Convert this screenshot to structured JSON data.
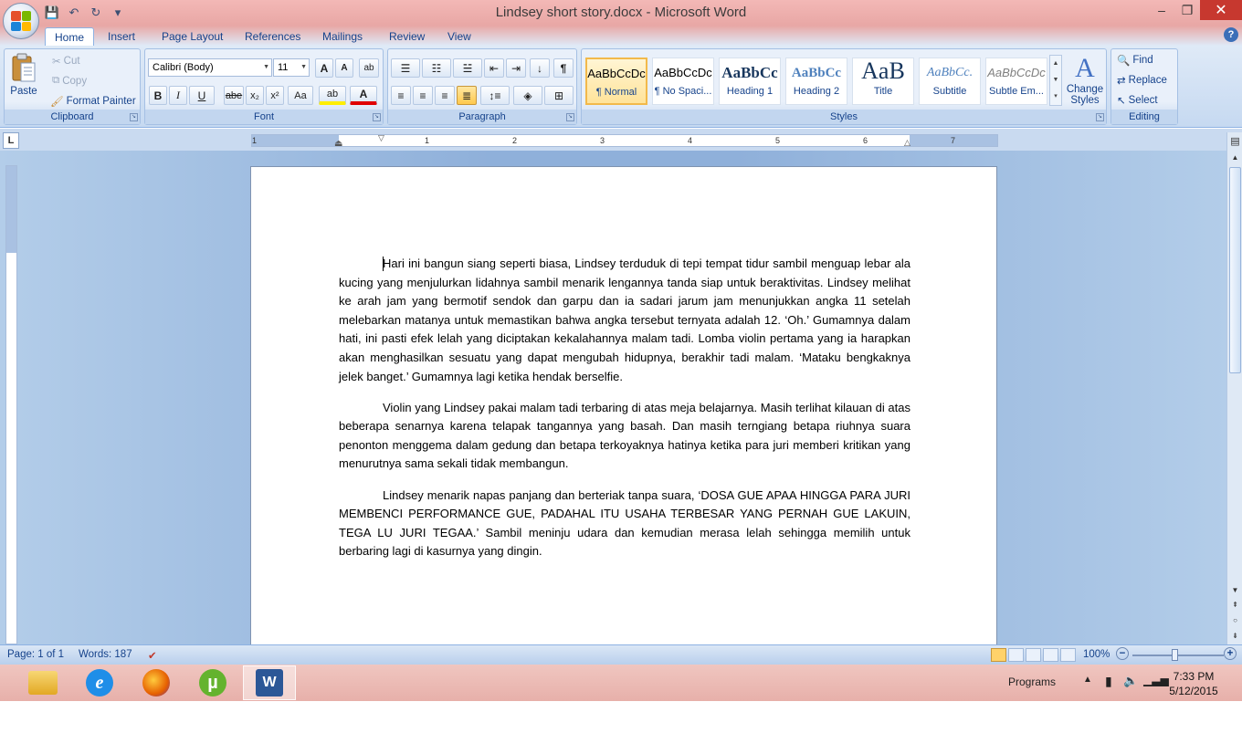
{
  "window": {
    "title": "Lindsey short story.docx - Microsoft Word",
    "minimize": "–",
    "restore": "❐",
    "close": "✕"
  },
  "qat": {
    "save": "💾",
    "undo": "↶",
    "redo": "↻",
    "more": "▾"
  },
  "tabs": [
    {
      "label": "Home",
      "active": true
    },
    {
      "label": "Insert"
    },
    {
      "label": "Page Layout"
    },
    {
      "label": "References"
    },
    {
      "label": "Mailings"
    },
    {
      "label": "Review"
    },
    {
      "label": "View"
    }
  ],
  "help": "?",
  "clipboard": {
    "label": "Clipboard",
    "paste": "Paste",
    "cut": "Cut",
    "copy": "Copy",
    "format_painter": "Format Painter"
  },
  "font": {
    "label": "Font",
    "family": "Calibri (Body)",
    "size": "11",
    "grow": "A",
    "shrink": "A",
    "clear": "ab",
    "bold": "B",
    "italic": "I",
    "underline": "U",
    "strike": "abe",
    "subscript": "x₂",
    "superscript": "x²",
    "case": "Aa",
    "highlight": "ab",
    "color": "A"
  },
  "paragraph": {
    "label": "Paragraph",
    "sort": "↓",
    "show_marks": "¶"
  },
  "styles": {
    "label": "Styles",
    "items": [
      {
        "preview": "AaBbCcDc",
        "name": "¶ Normal",
        "selected": true
      },
      {
        "preview": "AaBbCcDc",
        "name": "¶ No Spaci..."
      },
      {
        "preview": "AaBbCc",
        "name": "Heading 1"
      },
      {
        "preview": "AaBbCc",
        "name": "Heading 2"
      },
      {
        "preview": "AaB",
        "name": "Title"
      },
      {
        "preview": "AaBbCc.",
        "name": "Subtitle"
      },
      {
        "preview": "AaBbCcDc",
        "name": "Subtle Em..."
      }
    ],
    "change_styles": "Change Styles"
  },
  "editing": {
    "label": "Editing",
    "find": "Find",
    "replace": "Replace",
    "select": "Select"
  },
  "ruler": {
    "corner": "L",
    "numbers": [
      "1",
      "1",
      "2",
      "3",
      "4",
      "5",
      "6",
      "7"
    ]
  },
  "document": {
    "paragraphs": [
      "Hari ini bangun siang seperti biasa, Lindsey terduduk di tepi tempat tidur sambil menguap lebar ala kucing yang menjulurkan lidahnya sambil menarik lengannya tanda siap untuk beraktivitas. Lindsey melihat ke arah jam yang bermotif sendok dan garpu dan ia sadari jarum jam menunjukkan angka 11 setelah melebarkan matanya untuk memastikan bahwa angka tersebut ternyata adalah 12. ‘Oh.’ Gumamnya dalam hati, ini pasti efek lelah yang diciptakan kekalahannya malam tadi. Lomba violin pertama yang ia harapkan akan menghasilkan sesuatu yang dapat mengubah hidupnya, berakhir tadi malam. ‘Mataku bengkaknya jelek banget.’ Gumamnya lagi ketika hendak berselfie.",
      "Violin yang Lindsey pakai malam tadi terbaring di atas meja belajarnya. Masih terlihat kilauan di atas beberapa senarnya karena telapak tangannya yang basah. Dan masih terngiang betapa riuhnya suara penonton menggema dalam gedung dan betapa terkoyaknya hatinya ketika para juri memberi kritikan yang menurutnya sama sekali tidak membangun.",
      "Lindsey menarik napas panjang dan berteriak tanpa suara, ‘DOSA GUE APAA HINGGA PARA JURI MEMBENCI PERFORMANCE GUE, PADAHAL ITU USAHA TERBESAR YANG PERNAH GUE LAKUIN, TEGA LU JURI TEGAA.’ Sambil meninju udara dan kemudian merasa lelah sehingga memilih untuk berbaring lagi di kasurnya yang dingin."
    ]
  },
  "status": {
    "page": "Page: 1 of 1",
    "words": "Words: 187",
    "zoom": "100%",
    "zoom_out": "−",
    "zoom_in": "+"
  },
  "taskbar": {
    "programs": "Programs",
    "time": "7:33 PM",
    "date": "5/12/2015"
  },
  "colors": {
    "accent": "#15428b",
    "title_bar": "#e8a7a5",
    "close": "#c7382f",
    "workspace": "#8fb0da"
  }
}
